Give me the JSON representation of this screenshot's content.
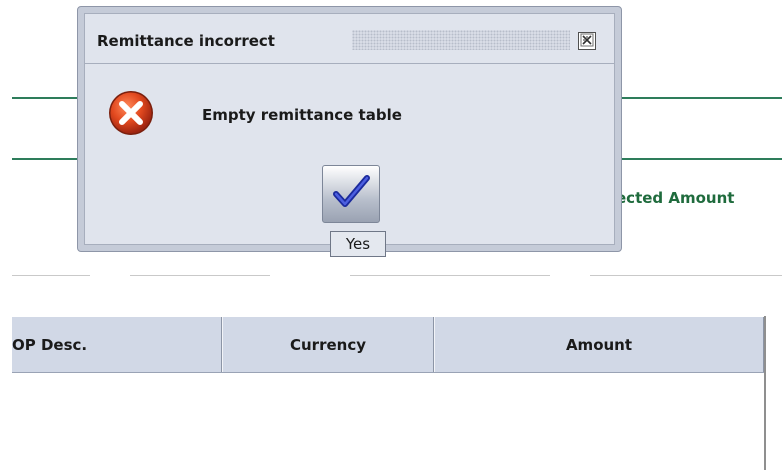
{
  "background": {
    "partial_label": "ected Amount",
    "table": {
      "columns": [
        "OP Desc.",
        "Currency",
        "Amount"
      ]
    }
  },
  "dialog": {
    "title": "Remittance incorrect",
    "message": "Empty remittance table",
    "icon": "error-icon",
    "close_icon": "close-icon",
    "yes_button_icon": "checkmark-icon",
    "yes_tooltip": "Yes"
  },
  "colors": {
    "accent_green": "#1f6b3d",
    "divider_green": "#2e7d5b",
    "dialog_bg": "#e0e4ed",
    "header_bg": "#d1d8e6",
    "error_red": "#d9411e"
  }
}
